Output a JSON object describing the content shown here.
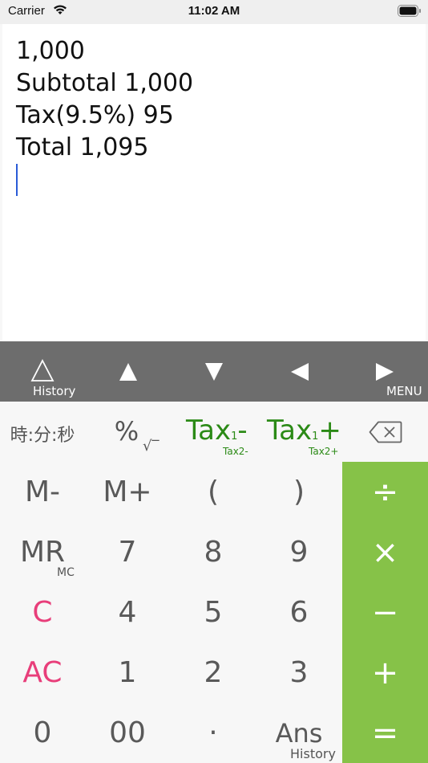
{
  "status_bar": {
    "carrier": "Carrier",
    "time": "11:02 AM"
  },
  "display": {
    "lines": [
      "1,000",
      "Subtotal 1,000",
      "Tax(9.5%) 95",
      "Total 1,095"
    ]
  },
  "nav_bar": {
    "history_label": "History",
    "menu_label": "MENU"
  },
  "function_row": {
    "hms": "時:分:秒",
    "percent": "%",
    "sqrt": "√‾",
    "tax_minus": {
      "main": "Tax",
      "sub": "1",
      "op": "-",
      "second": "Tax2-"
    },
    "tax_plus": {
      "main": "Tax",
      "sub": "1",
      "op": "+",
      "second": "Tax2+"
    }
  },
  "keypad": {
    "row1": [
      "M-",
      "M+",
      "(",
      ")"
    ],
    "row2": {
      "mr": "MR",
      "mc": "MC",
      "keys": [
        "7",
        "8",
        "9"
      ]
    },
    "row3": {
      "c": "C",
      "keys": [
        "4",
        "5",
        "6"
      ]
    },
    "row4": {
      "ac": "AC",
      "keys": [
        "1",
        "2",
        "3"
      ]
    },
    "row5": {
      "keys": [
        "0",
        "00",
        "·"
      ],
      "ans": "Ans",
      "ans_sub": "History"
    }
  },
  "operators": {
    "divide": "÷",
    "multiply": "×",
    "minus": "−",
    "plus": "+",
    "equals": "="
  },
  "colors": {
    "accent_green": "#86c248",
    "tax_green": "#2b8a16",
    "clear_pink": "#e83e7a",
    "nav_gray": "#6d6d6d"
  }
}
